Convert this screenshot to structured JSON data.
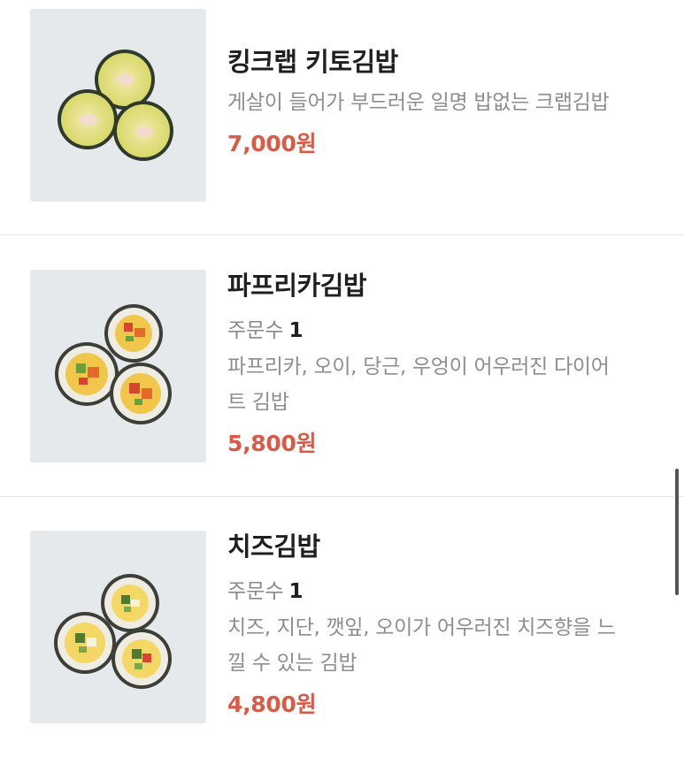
{
  "menu_items": [
    {
      "name": "킹크랩 키토김밥",
      "description": "게살이 들어가 부드러운 일명 밥없는 크랩김밥",
      "price": "7,000원",
      "image_icon": "kimbap-image"
    },
    {
      "name": "파프리카김밥",
      "orders_label": "주문수",
      "orders_count": "1",
      "description_line1": "파프리카, 오이, 당근, 우엉이 어우러진 다이어",
      "description_line2": "트 김밥",
      "price": "5,800원",
      "image_icon": "kimbap-image"
    },
    {
      "name": "치즈김밥",
      "orders_label": "주문수",
      "orders_count": "1",
      "description_line1": "치즈, 지단, 깻잎, 오이가 어우러진 치즈향을 느",
      "description_line2": "낄 수 있는 김밥",
      "price": "4,800원",
      "image_icon": "kimbap-image"
    }
  ],
  "colors": {
    "price": "#d95b47",
    "name": "#1f1f1f",
    "muted": "#8e8e8e",
    "thumb_bg": "#e6e9ec"
  }
}
